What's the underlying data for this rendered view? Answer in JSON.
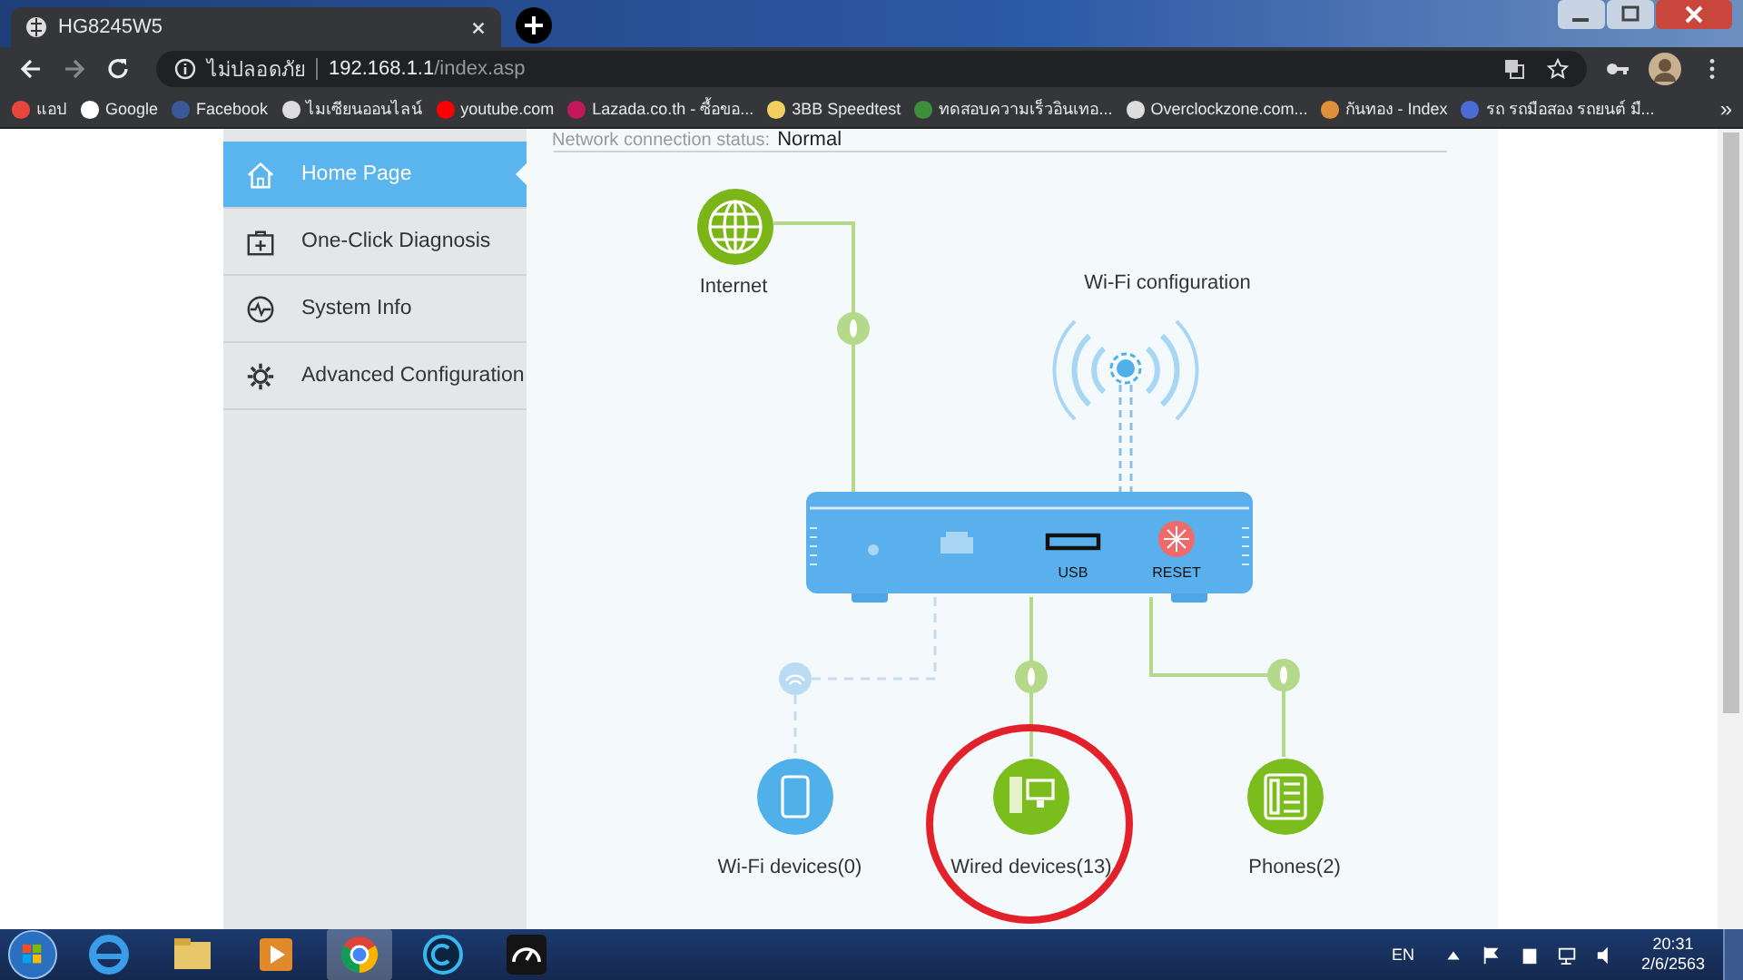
{
  "browser": {
    "tab_title": "HG8245W5",
    "security_label": "ไม่ปลอดภัย",
    "url_host": "192.168.1.1",
    "url_path": "/index.asp",
    "bookmarks": [
      {
        "kind": "apps",
        "label": "แอป"
      },
      {
        "kind": "google",
        "label": "Google"
      },
      {
        "kind": "facebook",
        "label": "Facebook"
      },
      {
        "kind": "globe",
        "label": "ไมเซียนออนไลน์"
      },
      {
        "kind": "youtube",
        "label": "youtube.com"
      },
      {
        "kind": "lazada",
        "label": "Lazada.co.th - ซื้อขอ..."
      },
      {
        "kind": "speed",
        "label": "3BB Speedtest"
      },
      {
        "kind": "test",
        "label": "ทดสอบความเร็วอินเทอ..."
      },
      {
        "kind": "globe",
        "label": "Overclockzone.com..."
      },
      {
        "kind": "orange",
        "label": "กันทอง - Index"
      },
      {
        "kind": "k",
        "label": "รถ รถมือสอง รถยนต์ มื..."
      }
    ],
    "more": "»"
  },
  "sidebar": {
    "items": [
      {
        "kind": "home",
        "label": "Home Page",
        "selected": true
      },
      {
        "kind": "diagnosis",
        "label": "One-Click Diagnosis",
        "selected": false
      },
      {
        "kind": "info",
        "label": "System Info",
        "selected": false
      },
      {
        "kind": "config",
        "label": "Advanced Configuration",
        "selected": false
      }
    ]
  },
  "diagram": {
    "status_label": "Network connection status:",
    "status_value": "Normal",
    "internet_label": "Internet",
    "wifi_config_label": "Wi-Fi configuration",
    "usb_label": "USB",
    "reset_label": "RESET",
    "devices": [
      {
        "kind": "wifi",
        "label": "Wi-Fi devices(0)"
      },
      {
        "kind": "wired",
        "label": "Wired devices(13)"
      },
      {
        "kind": "phone",
        "label": "Phones(2)"
      }
    ]
  },
  "taskbar": {
    "language": "EN",
    "time": "20:31",
    "date": "2/6/2563"
  }
}
